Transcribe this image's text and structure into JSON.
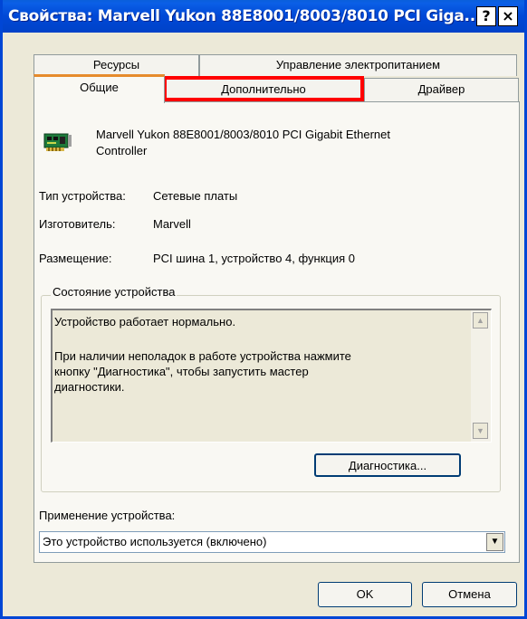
{
  "window": {
    "title": "Свойства: Marvell Yukon 88E8001/8003/8010 PCI Giga...",
    "help_label": "?",
    "close_label": "×"
  },
  "tabs": {
    "back_row": [
      "Ресурсы",
      "Управление электропитанием"
    ],
    "front_row": [
      "Общие",
      "Дополнительно",
      "Драйвер"
    ],
    "active": "Общие"
  },
  "device": {
    "icon": "network-card-icon",
    "name_line1": "Marvell Yukon 88E8001/8003/8010 PCI Gigabit Ethernet",
    "name_line2": "Controller"
  },
  "properties": {
    "type_label": "Тип устройства:",
    "type_value": "Сетевые платы",
    "manufacturer_label": "Изготовитель:",
    "manufacturer_value": "Marvell",
    "location_label": "Размещение:",
    "location_value": "PCI шина 1, устройство 4, функция 0"
  },
  "status": {
    "group_label": "Состояние устройства",
    "line1": "Устройство работает нормально.",
    "line2": "При наличии неполадок в работе устройства нажмите",
    "line3": "кнопку \"Диагностика\", чтобы запустить мастер",
    "line4": "диагностики.",
    "diagnostics_button": "Диагностика..."
  },
  "usage": {
    "label": "Применение устройства:",
    "selected": "Это устройство используется (включено)"
  },
  "footer": {
    "ok_label": "OK",
    "cancel_label": "Отмена"
  },
  "colors": {
    "titlebar": "#0048d6",
    "highlight": "#ff0000",
    "dialog": "#ece9d8"
  }
}
